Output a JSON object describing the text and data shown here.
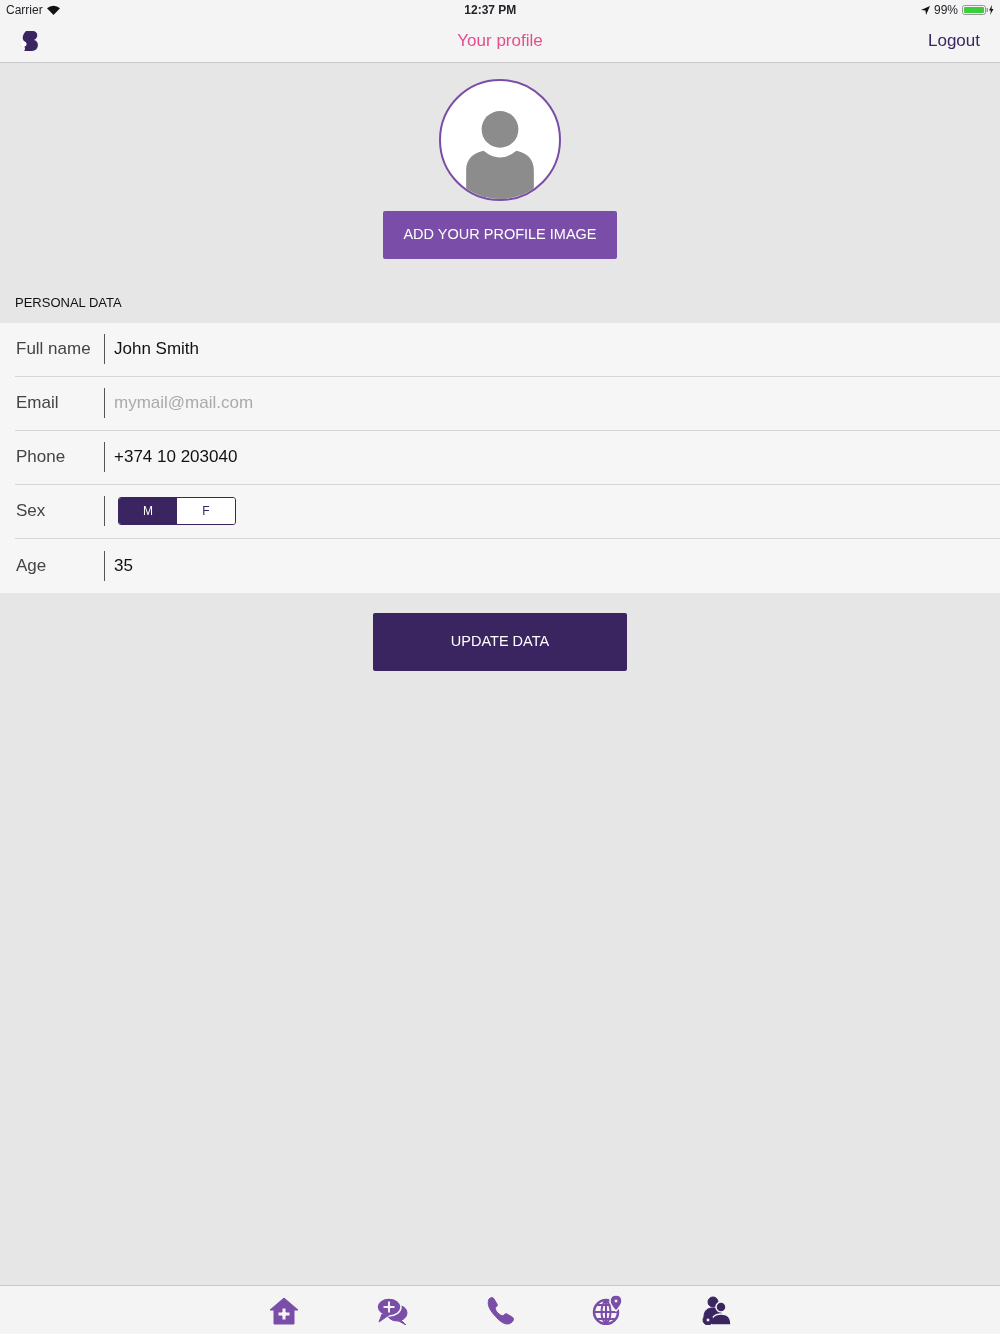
{
  "status_bar": {
    "carrier": "Carrier",
    "time": "12:37 PM",
    "battery": "99%"
  },
  "nav_bar": {
    "title": "Your profile",
    "right_button": "Logout"
  },
  "profile": {
    "add_image_button": "ADD YOUR PROFILE IMAGE"
  },
  "section_title": "PERSONAL DATA",
  "fields": [
    {
      "kind": "text",
      "label": "Full name",
      "value": "John Smith"
    },
    {
      "kind": "text",
      "label": "Email",
      "placeholder": "mymail@mail.com"
    },
    {
      "kind": "text",
      "label": "Phone",
      "value": "+374 10 203040"
    },
    {
      "kind": "segmented",
      "label": "Sex",
      "options": [
        {
          "label": "M",
          "selected": true
        },
        {
          "label": "F",
          "selected": false
        }
      ]
    },
    {
      "kind": "text",
      "label": "Age",
      "value": "35"
    }
  ],
  "update_button": "UPDATE DATA",
  "tab_bar": [
    {
      "kind": "home",
      "selected": false
    },
    {
      "kind": "chat",
      "selected": false
    },
    {
      "kind": "phone",
      "selected": false
    },
    {
      "kind": "globe",
      "selected": false
    },
    {
      "kind": "users",
      "selected": true
    }
  ]
}
